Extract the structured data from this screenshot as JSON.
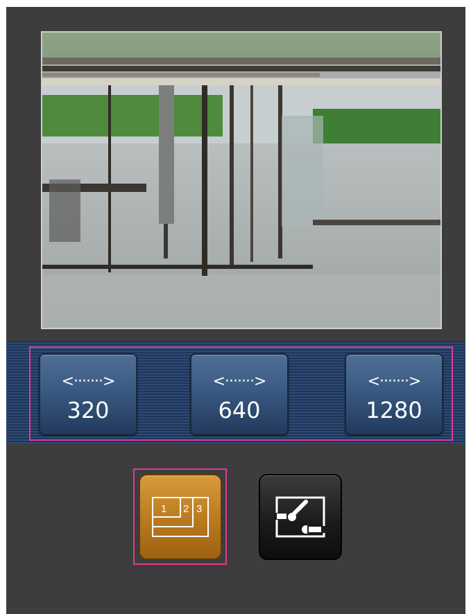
{
  "camera": {
    "image_name": "camera-live-image"
  },
  "resolution": {
    "buttons": [
      {
        "arrow": "<·······>",
        "label": "320"
      },
      {
        "arrow": "<·······>",
        "label": "640"
      },
      {
        "arrow": "<·······>",
        "label": "1280"
      }
    ]
  },
  "controls": {
    "multi_screen": {
      "numbers": [
        "1",
        "2",
        "3"
      ],
      "icon": "multi-screen-icon"
    },
    "control_panel": {
      "icon": "control-toggle-icon"
    }
  },
  "colors": {
    "background": "#3d3d3d",
    "band": "#24395c",
    "highlight": "#e23a92",
    "active_button": "#c6852a"
  }
}
